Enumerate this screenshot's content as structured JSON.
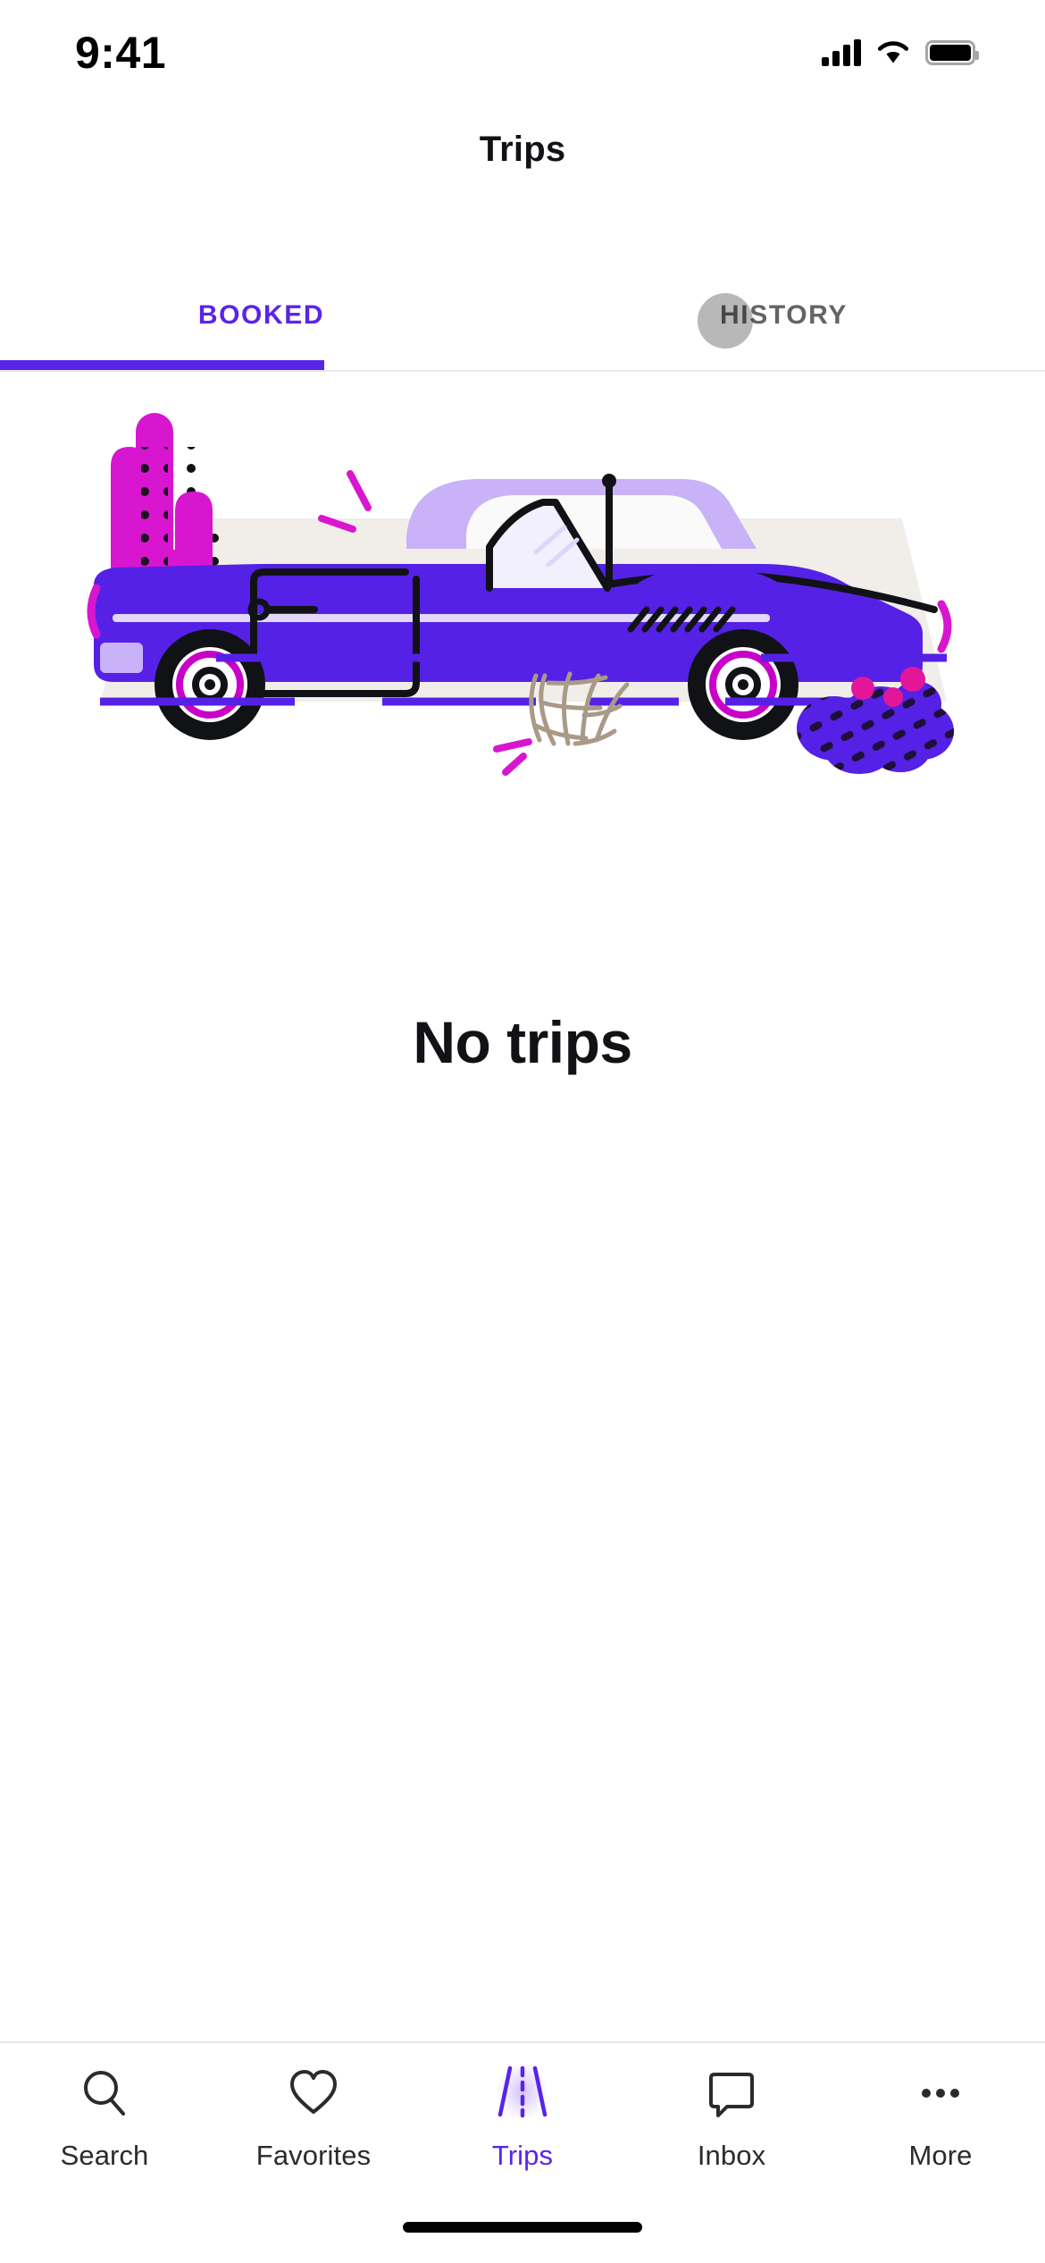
{
  "status_bar": {
    "time": "9:41",
    "signal_icon": "cellular-signal-icon",
    "wifi_icon": "wifi-icon",
    "battery_icon": "battery-full-icon"
  },
  "header": {
    "title": "Trips"
  },
  "segmented_tabs": {
    "items": [
      {
        "label": "BOOKED",
        "active": true
      },
      {
        "label": "HISTORY",
        "active": false
      }
    ],
    "active_color": "#5a24e8",
    "inactive_color": "#646464"
  },
  "illustration": {
    "name": "empty-trips-desert-car-illustration",
    "alt": "Purple convertible car on a desert road with cactus, tumbleweed and shrub",
    "colors": {
      "car_body": "#5521e6",
      "car_roof": "#c9b2f7",
      "cactus": "#d916cf",
      "ground": "#f1eeea",
      "road_line": "#5521e6",
      "tumbleweed": "#a99a87",
      "wheel": "#111216",
      "wheel_rim": "#c800c8"
    }
  },
  "empty_state": {
    "title": "No trips"
  },
  "bottom_nav": {
    "items": [
      {
        "label": "Search",
        "icon": "search-icon",
        "active": false
      },
      {
        "label": "Favorites",
        "icon": "heart-icon",
        "active": false
      },
      {
        "label": "Trips",
        "icon": "road-icon",
        "active": true
      },
      {
        "label": "Inbox",
        "icon": "chat-bubble-icon",
        "active": false
      },
      {
        "label": "More",
        "icon": "more-dots-icon",
        "active": false
      }
    ],
    "active_color": "#5a24e8",
    "inactive_color": "#2b2b2f"
  },
  "home_indicator": {
    "name": "home-indicator"
  }
}
